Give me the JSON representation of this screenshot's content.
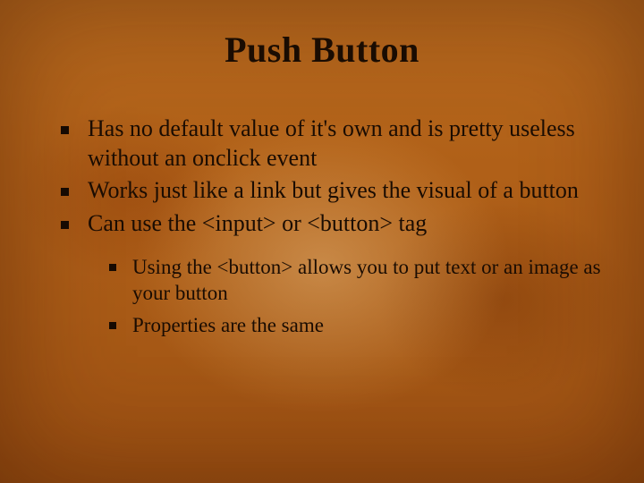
{
  "slide": {
    "title": "Push Button",
    "bullets": [
      "Has no default value of it's own and is pretty useless without an onclick event",
      "Works just like a link but gives the visual of a button",
      "Can use the <input> or <button> tag"
    ],
    "sub_bullets": [
      "Using the <button> allows you to put text or an image as your button",
      "Properties are the same"
    ]
  }
}
